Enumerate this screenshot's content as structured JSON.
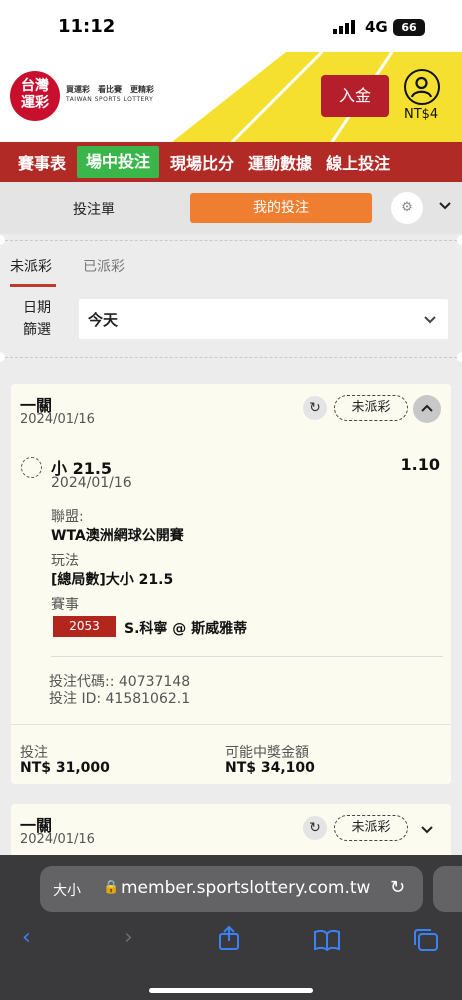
{
  "status_bar": {
    "time": "11:12",
    "network": "4G",
    "battery": "66"
  },
  "header": {
    "logo_line1": "台灣",
    "logo_line2": "運彩",
    "tagline": "買運彩　看比賽　更精彩",
    "subtitle": "TAIWAN SPORTS LOTTERY",
    "deposit_label": "入金",
    "balance": "NT$4"
  },
  "nav": {
    "items": [
      "賽事表",
      "場中投注",
      "現場比分",
      "運動數據",
      "線上投注"
    ],
    "active_index": 1
  },
  "bet_tabs": {
    "slip_label": "投注單",
    "my_bets_label": "我的投注"
  },
  "sub_tabs": {
    "unsettled": "未派彩",
    "settled": "已派彩"
  },
  "date_filter": {
    "label_line1": "日期",
    "label_line2": "篩選",
    "value": "今天"
  },
  "cards": [
    {
      "type": "一關",
      "date": "2024/01/16",
      "status": "未派彩",
      "selection": "小 21.5",
      "odds": "1.10",
      "selection_date": "2024/01/16",
      "league_label": "聯盟:",
      "league": "WTA澳洲網球公開賽",
      "market_label": "玩法",
      "market": "[總局數]大小 21.5",
      "event_label": "賽事",
      "event_code": "2053",
      "event_name": "S.科寧 @ 斯威雅蒂",
      "bet_code": "投注代碼:: 40737148",
      "bet_id": "投注 ID: 41581062.1",
      "stake_label": "投注",
      "stake": "NT$ 31,000",
      "payout_label": "可能中獎金額",
      "payout": "NT$ 34,100"
    },
    {
      "type": "一關",
      "date": "2024/01/16",
      "status": "未派彩"
    }
  ],
  "browser": {
    "text_size": "大小",
    "url": "member.sportslottery.com.tw"
  }
}
